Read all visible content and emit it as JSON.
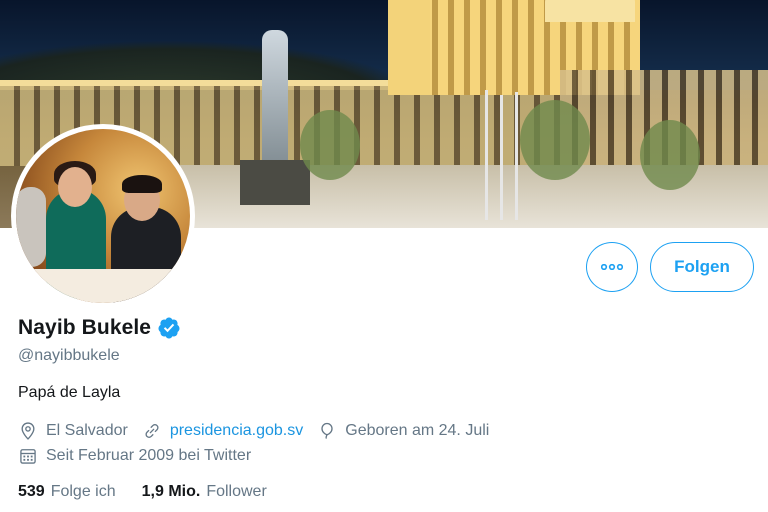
{
  "profile": {
    "name": "Nayib Bukele",
    "handle": "@nayibbukele",
    "bio": "Papá de Layla",
    "location": "El Salvador",
    "website": "presidencia.gob.sv",
    "birthday": "Geboren am 24. Juli",
    "joined": "Seit Februar 2009 bei Twitter"
  },
  "actions": {
    "more_icon": "more-horizontal-icon",
    "follow_label": "Folgen"
  },
  "stats": {
    "following_count": "539",
    "following_label": "Folge ich",
    "followers_count": "1,9 Mio.",
    "followers_label": "Follower"
  },
  "icons": {
    "verified": "verified-badge-icon",
    "location": "location-pin-icon",
    "link": "link-icon",
    "birthday": "balloon-icon",
    "calendar": "calendar-icon"
  },
  "colors": {
    "accent": "#1da1f2",
    "link": "#1b95e0",
    "secondary_text": "#657786",
    "primary_text": "#14171a"
  }
}
